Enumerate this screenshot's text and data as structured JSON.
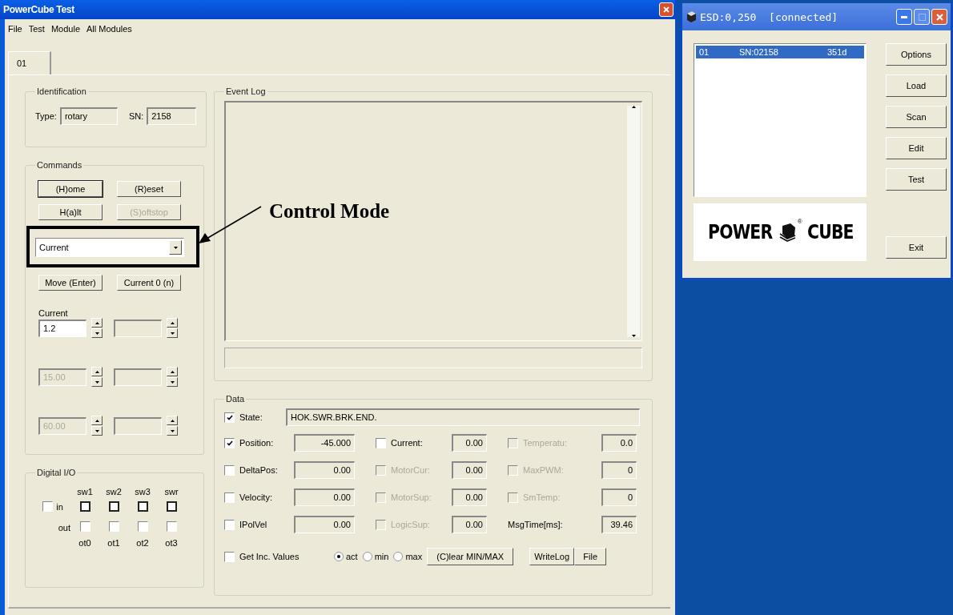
{
  "main_window": {
    "title": "PowerCube Test",
    "menu": [
      "File",
      "Test",
      "Module",
      "All Modules"
    ],
    "tabs": [
      {
        "label": "01",
        "selected": true
      }
    ],
    "identification": {
      "title": "Identification",
      "type_label": "Type:",
      "type_value": "rotary",
      "sn_label": "SN:",
      "sn_value": "2158"
    },
    "commands": {
      "title": "Commands",
      "buttons": [
        {
          "label": "(H)ome",
          "disabled": false,
          "default": true
        },
        {
          "label": "(R)eset",
          "disabled": false,
          "default": false
        },
        {
          "label": "H(a)lt",
          "disabled": false,
          "default": false
        },
        {
          "label": "(S)oftstop",
          "disabled": true,
          "default": false
        }
      ],
      "mode": "Current",
      "buttons2": [
        {
          "label": "Move (Enter)",
          "disabled": false,
          "default": false
        },
        {
          "label": "Current 0 (n)",
          "disabled": false,
          "default": false
        }
      ],
      "spin_label": "Current",
      "spins": [
        {
          "value": "1.2",
          "disabled": false
        },
        {
          "disabled": true
        },
        {
          "value": "15.00",
          "disabled": true
        },
        {
          "disabled": true
        },
        {
          "value": "60.00",
          "disabled": true
        },
        {
          "disabled": true
        }
      ]
    },
    "digital_io": {
      "title": "Digital I/O",
      "in_label": "in",
      "in_checked": false,
      "switches": [
        "sw1",
        "sw2",
        "sw3",
        "swr"
      ],
      "out_label": "out",
      "outputs": [
        {
          "label": "ot0",
          "checked": false
        },
        {
          "label": "ot1",
          "checked": false
        },
        {
          "label": "ot2",
          "checked": false
        },
        {
          "label": "ot3",
          "checked": false
        }
      ]
    },
    "event_log": {
      "title": "Event Log"
    },
    "data": {
      "title": "Data",
      "state": {
        "label": "State:",
        "checked": true,
        "value": "HOK.SWR.BRK.END."
      },
      "rows": [
        [
          {
            "kind": "check",
            "label": "Position:",
            "checked": true,
            "disabled": false,
            "value": "-45.000"
          },
          {
            "kind": "check",
            "label": "Current:",
            "checked": false,
            "disabled": false,
            "value": "0.00"
          },
          {
            "kind": "check",
            "label": "Temperatu:",
            "checked": false,
            "disabled": true,
            "value": "0.0"
          }
        ],
        [
          {
            "kind": "check",
            "label": "DeltaPos:",
            "checked": false,
            "disabled": false,
            "value": "0.00"
          },
          {
            "kind": "check",
            "label": "MotorCur:",
            "checked": false,
            "disabled": true,
            "value": "0.00"
          },
          {
            "kind": "check",
            "label": "MaxPWM:",
            "checked": false,
            "disabled": true,
            "value": "0"
          }
        ],
        [
          {
            "kind": "check",
            "label": "Velocity:",
            "checked": false,
            "disabled": false,
            "value": "0.00"
          },
          {
            "kind": "check",
            "label": "MotorSup:",
            "checked": false,
            "disabled": true,
            "value": "0.00"
          },
          {
            "kind": "check",
            "label": "SmTemp:",
            "checked": false,
            "disabled": true,
            "value": "0"
          }
        ],
        [
          {
            "kind": "check",
            "label": "IPolVel",
            "checked": false,
            "disabled": false,
            "value": "0.00"
          },
          {
            "kind": "check",
            "label": "LogicSup:",
            "checked": false,
            "disabled": true,
            "value": "0.00"
          },
          {
            "kind": "label",
            "label": "MsgTime[ms]:",
            "value": "39.46"
          }
        ]
      ],
      "inc": {
        "label": "Get Inc. Values",
        "checked": false
      },
      "radios": [
        {
          "label": "act",
          "selected": true
        },
        {
          "label": "min",
          "selected": false
        },
        {
          "label": "max",
          "selected": false
        }
      ],
      "buttons": [
        "(C)lear MIN/MAX",
        "WriteLog",
        "File"
      ]
    }
  },
  "annotation": {
    "text": "Control Mode"
  },
  "module_window": {
    "title": "ESD:0,250  [connected]",
    "modules": [
      {
        "columns": [
          "01",
          "SN:02158",
          "351d"
        ],
        "selected": true
      }
    ],
    "logo": {
      "left": "POWER",
      "right": "CUBE",
      "mark": "®"
    },
    "buttons": [
      "Options",
      "Load",
      "Scan",
      "Edit",
      "Test"
    ],
    "exit": "Exit"
  }
}
